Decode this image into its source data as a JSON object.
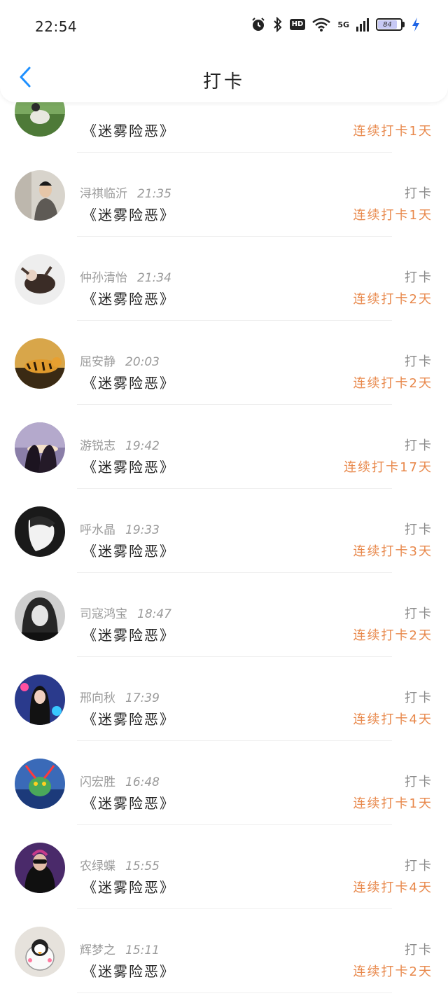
{
  "status_bar": {
    "time": "22:54",
    "network": "5G",
    "hd": "HD",
    "battery": "84"
  },
  "header": {
    "title": "打卡"
  },
  "colors": {
    "streak": "#e8884b",
    "accent": "#1e90ff"
  },
  "items": [
    {
      "name": "",
      "time": "",
      "book": "《迷雾险恶》",
      "action": "",
      "streak": "连续打卡1天"
    },
    {
      "name": "浔祺临沂",
      "time": "21:35",
      "book": "《迷雾险恶》",
      "action": "打卡",
      "streak": "连续打卡1天"
    },
    {
      "name": "仲孙清怡",
      "time": "21:34",
      "book": "《迷雾险恶》",
      "action": "打卡",
      "streak": "连续打卡2天"
    },
    {
      "name": "屈安静",
      "time": "20:03",
      "book": "《迷雾险恶》",
      "action": "打卡",
      "streak": "连续打卡2天"
    },
    {
      "name": "游锐志",
      "time": "19:42",
      "book": "《迷雾险恶》",
      "action": "打卡",
      "streak": "连续打卡17天"
    },
    {
      "name": "呼水晶",
      "time": "19:33",
      "book": "《迷雾险恶》",
      "action": "打卡",
      "streak": "连续打卡3天"
    },
    {
      "name": "司寇鸿宝",
      "time": "18:47",
      "book": "《迷雾险恶》",
      "action": "打卡",
      "streak": "连续打卡2天"
    },
    {
      "name": "邢向秋",
      "time": "17:39",
      "book": "《迷雾险恶》",
      "action": "打卡",
      "streak": "连续打卡4天"
    },
    {
      "name": "闪宏胜",
      "time": "16:48",
      "book": "《迷雾险恶》",
      "action": "打卡",
      "streak": "连续打卡1天"
    },
    {
      "name": "农绿蝶",
      "time": "15:55",
      "book": "《迷雾险恶》",
      "action": "打卡",
      "streak": "连续打卡4天"
    },
    {
      "name": "辉梦之",
      "time": "15:11",
      "book": "《迷雾险恶》",
      "action": "打卡",
      "streak": "连续打卡2天"
    }
  ]
}
